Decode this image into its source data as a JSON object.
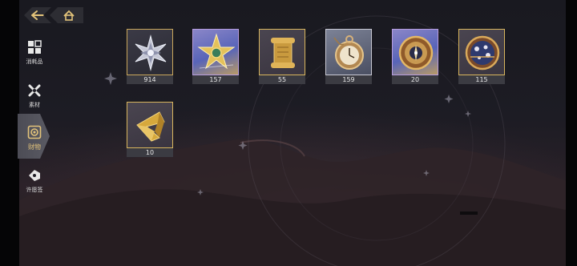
{
  "nav": {
    "back_icon": "back-arrow-icon",
    "home_icon": "home-icon"
  },
  "sidebar": {
    "items": [
      {
        "label": "消耗品",
        "icon": "consumables-icon",
        "active": false
      },
      {
        "label": "素材",
        "icon": "materials-icon",
        "active": false
      },
      {
        "label": "财物",
        "icon": "treasure-icon",
        "active": true
      },
      {
        "label": "许愿签",
        "icon": "wish-tag-icon",
        "active": false
      }
    ]
  },
  "inventory": {
    "items": [
      {
        "name": "silver-star-crystal",
        "count": "914"
      },
      {
        "name": "golden-star-badge",
        "count": "157"
      },
      {
        "name": "golden-scroll",
        "count": "55"
      },
      {
        "name": "pocket-watch",
        "count": "159"
      },
      {
        "name": "compass-medallion",
        "count": "20"
      },
      {
        "name": "star-chart-disc",
        "count": "115"
      },
      {
        "name": "golden-impossible-triangle",
        "count": "10"
      }
    ]
  },
  "colors": {
    "accent_gold": "#e3c37a",
    "frame_gold": "#c9a65b",
    "count_bg": "#3b3b42"
  }
}
